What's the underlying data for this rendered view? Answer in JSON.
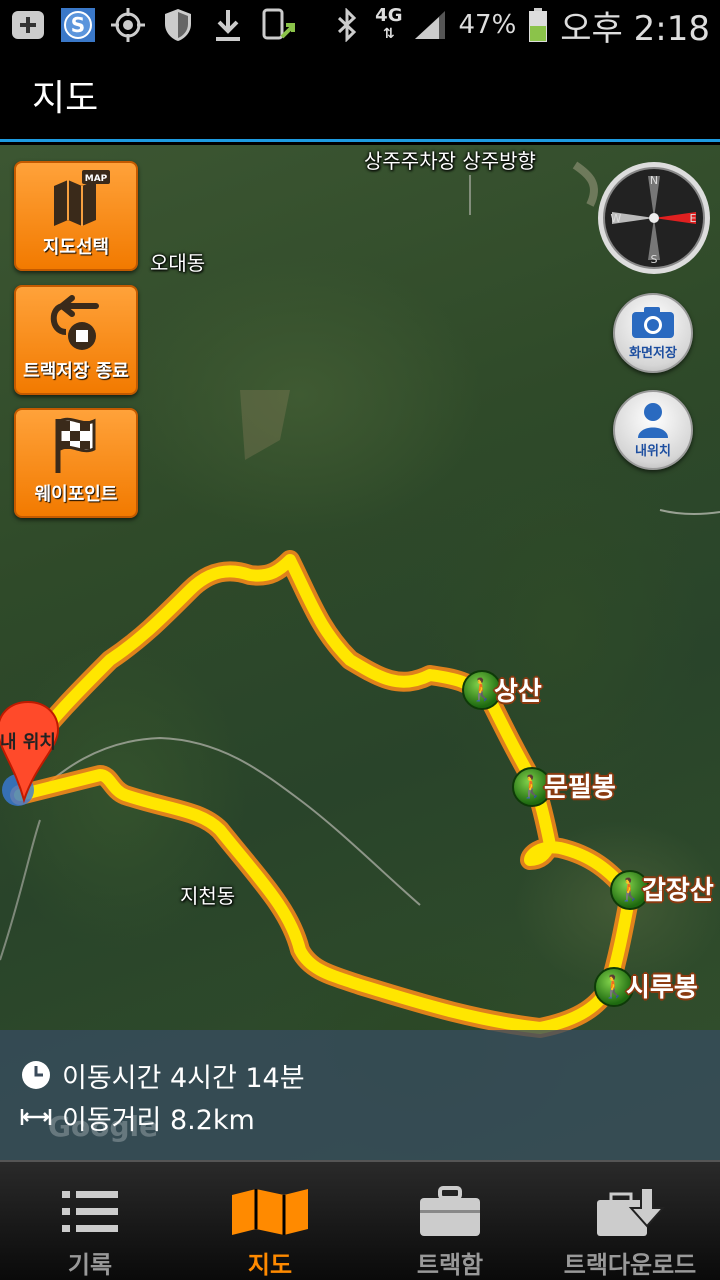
{
  "status_bar": {
    "icons_left": [
      "add-icon",
      "s-app-icon",
      "gps-icon",
      "shield-icon",
      "download-icon",
      "phone-upload-icon"
    ],
    "network": "4G",
    "battery_percent": "47%",
    "time": "오후 2:18"
  },
  "header": {
    "title": "지도"
  },
  "map": {
    "labels": {
      "parking": "상주주차장 상주방향",
      "odae": "오대동",
      "jicheon": "지천동"
    },
    "peaks": [
      "상산",
      "문필봉",
      "갑장산",
      "시루봉"
    ],
    "my_location": "내 위치",
    "route_color": "#ffe600"
  },
  "left_buttons": {
    "map_select": "지도선택",
    "map_badge": "MAP",
    "track_stop": "트랙저장 종료",
    "waypoint": "웨이포인트"
  },
  "right_buttons": {
    "screenshot": "화면저장",
    "my_position": "내위치",
    "compass_n": "N",
    "compass_s": "S",
    "compass_w": "W",
    "compass_e": "E"
  },
  "info": {
    "time_label": "이동시간 4시간 14분",
    "distance_label": "이동거리 8.2km",
    "watermark": "Google"
  },
  "bottom_nav": {
    "items": [
      {
        "label": "기록",
        "icon": "list-icon",
        "active": false
      },
      {
        "label": "지도",
        "icon": "map-icon",
        "active": true
      },
      {
        "label": "트랙함",
        "icon": "briefcase-icon",
        "active": false
      },
      {
        "label": "트랙다운로드",
        "icon": "download-box-icon",
        "active": false
      }
    ]
  },
  "colors": {
    "accent": "#ff8a00",
    "title_underline": "#1e9be0",
    "button_orange": "#f27a00"
  }
}
